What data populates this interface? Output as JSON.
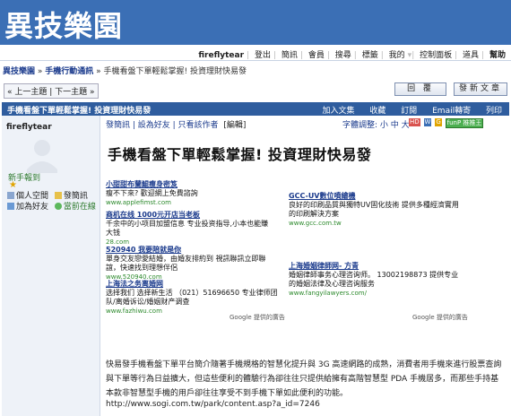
{
  "site": {
    "logo": "異技樂園"
  },
  "topnav": {
    "user": "fireflytear",
    "items": [
      "登出",
      "簡訊",
      "會員",
      "搜尋",
      "標籤",
      "我的",
      "控制面板",
      "道具",
      "幫助"
    ]
  },
  "breadcrumb": {
    "home": "異技樂園",
    "forum": "手機行動通訊",
    "thread": "手機看盤下單輕鬆掌握! 投資理財快易發"
  },
  "pager": {
    "prev": "上一主題",
    "next": "下一主題"
  },
  "buttons": {
    "reply": "回 覆",
    "new_post": "發新文章"
  },
  "threadbar": {
    "title": "手機看盤下單輕鬆掌握! 投資理財快易發",
    "actions": [
      "加入文集",
      "收藏",
      "訂閱",
      "Email轉寄",
      "列印"
    ]
  },
  "user": {
    "name": "fireflytear",
    "reg": "新手報到",
    "links": [
      "個人空間",
      "發簡訊",
      "加為好友",
      "當前在線"
    ]
  },
  "post": {
    "actions": "發簡訊 | 設為好友 | 只看該作者",
    "edit": "[編輯]",
    "fontsize": "字體調整: 小 中 大",
    "badges": [
      "HD",
      "W",
      "G",
      "funP 推推王"
    ],
    "title": "手機看盤下單輕鬆掌握! 投資理財快易發",
    "body": "快易發手機看盤下單平台簡介隨著手機規格的智慧化提升與 3G 高速網路的成熟，消費者用手機來進行股票查詢與下單等行為日益擴大，但這些便利的體驗行為卻往往只提供給擁有高階智慧型 PDA 手機居多，而那些手持基本款非智慧型手機的用戶卻往往享受不到手機下單如此便利的功能。",
    "link": "http://www.sogi.com.tw/park/content.asp?a_id=7246"
  },
  "ads_left": [
    {
      "title": "小甜甜布蘭鯤瘦身密笈",
      "body": "瘦不下來? 歡迎網上免費諮詢",
      "url": "www.applefimst.com"
    },
    {
      "title": "商机在线 1000元开店当老板",
      "body": "千余中的小项目加盟信息 专业投资指导,小本也能賺大钱",
      "url": "28.com"
    },
    {
      "title": "520940 我要陪就是你",
      "body": "單身交友戀愛結婚，由婚友排約到 視訊聯訊立即聯誼，快速找到理想伴侶",
      "url": "www.520940.com"
    },
    {
      "title": "上海法之务离婚网",
      "body": "选择我们 选择新生活 （021）51696650 专业律师团队/离婚诉讼/婚姻财产调查",
      "url": "www.fazhiwu.com"
    }
  ],
  "ads_right": [
    {
      "title": "GCC-UV數位噴繪機",
      "body": "良好的印刷品質與獨特UV固化技術 提供多種經濟實用的印刷解決方案",
      "url": "www.gcc.com.tw"
    },
    {
      "title": "上海婚姻律師网- 方青",
      "body": "婚姻律師事务心理咨询师。 13002198873 提供专业的婚姻法律及心理咨询服务",
      "url": "www.fangyilawyers.com/"
    }
  ],
  "google_label": "Google 提供的廣告"
}
